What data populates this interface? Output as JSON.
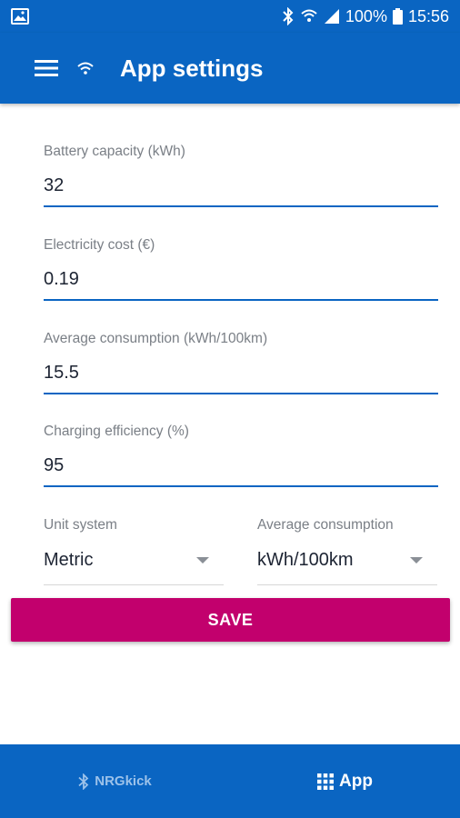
{
  "status_bar": {
    "battery": "100%",
    "time": "15:56"
  },
  "app_bar": {
    "title": "App settings"
  },
  "fields": [
    {
      "label": "Battery capacity (kWh)",
      "value": "32"
    },
    {
      "label": "Electricity cost (€)",
      "value": "0.19"
    },
    {
      "label": "Average consumption (kWh/100km)",
      "value": "15.5"
    },
    {
      "label": "Charging efficiency (%)",
      "value": "95"
    }
  ],
  "dropdowns": [
    {
      "label": "Unit system",
      "value": "Metric"
    },
    {
      "label": "Average consumption",
      "value": "kWh/100km"
    }
  ],
  "save_label": "SAVE",
  "bottom_nav": [
    {
      "label": "NRGkick",
      "icon": "bluetooth-icon",
      "active": false
    },
    {
      "label": "App",
      "icon": "grid-icon",
      "active": true
    }
  ],
  "colors": {
    "primary": "#0a65c2",
    "accent": "#c2006d"
  }
}
